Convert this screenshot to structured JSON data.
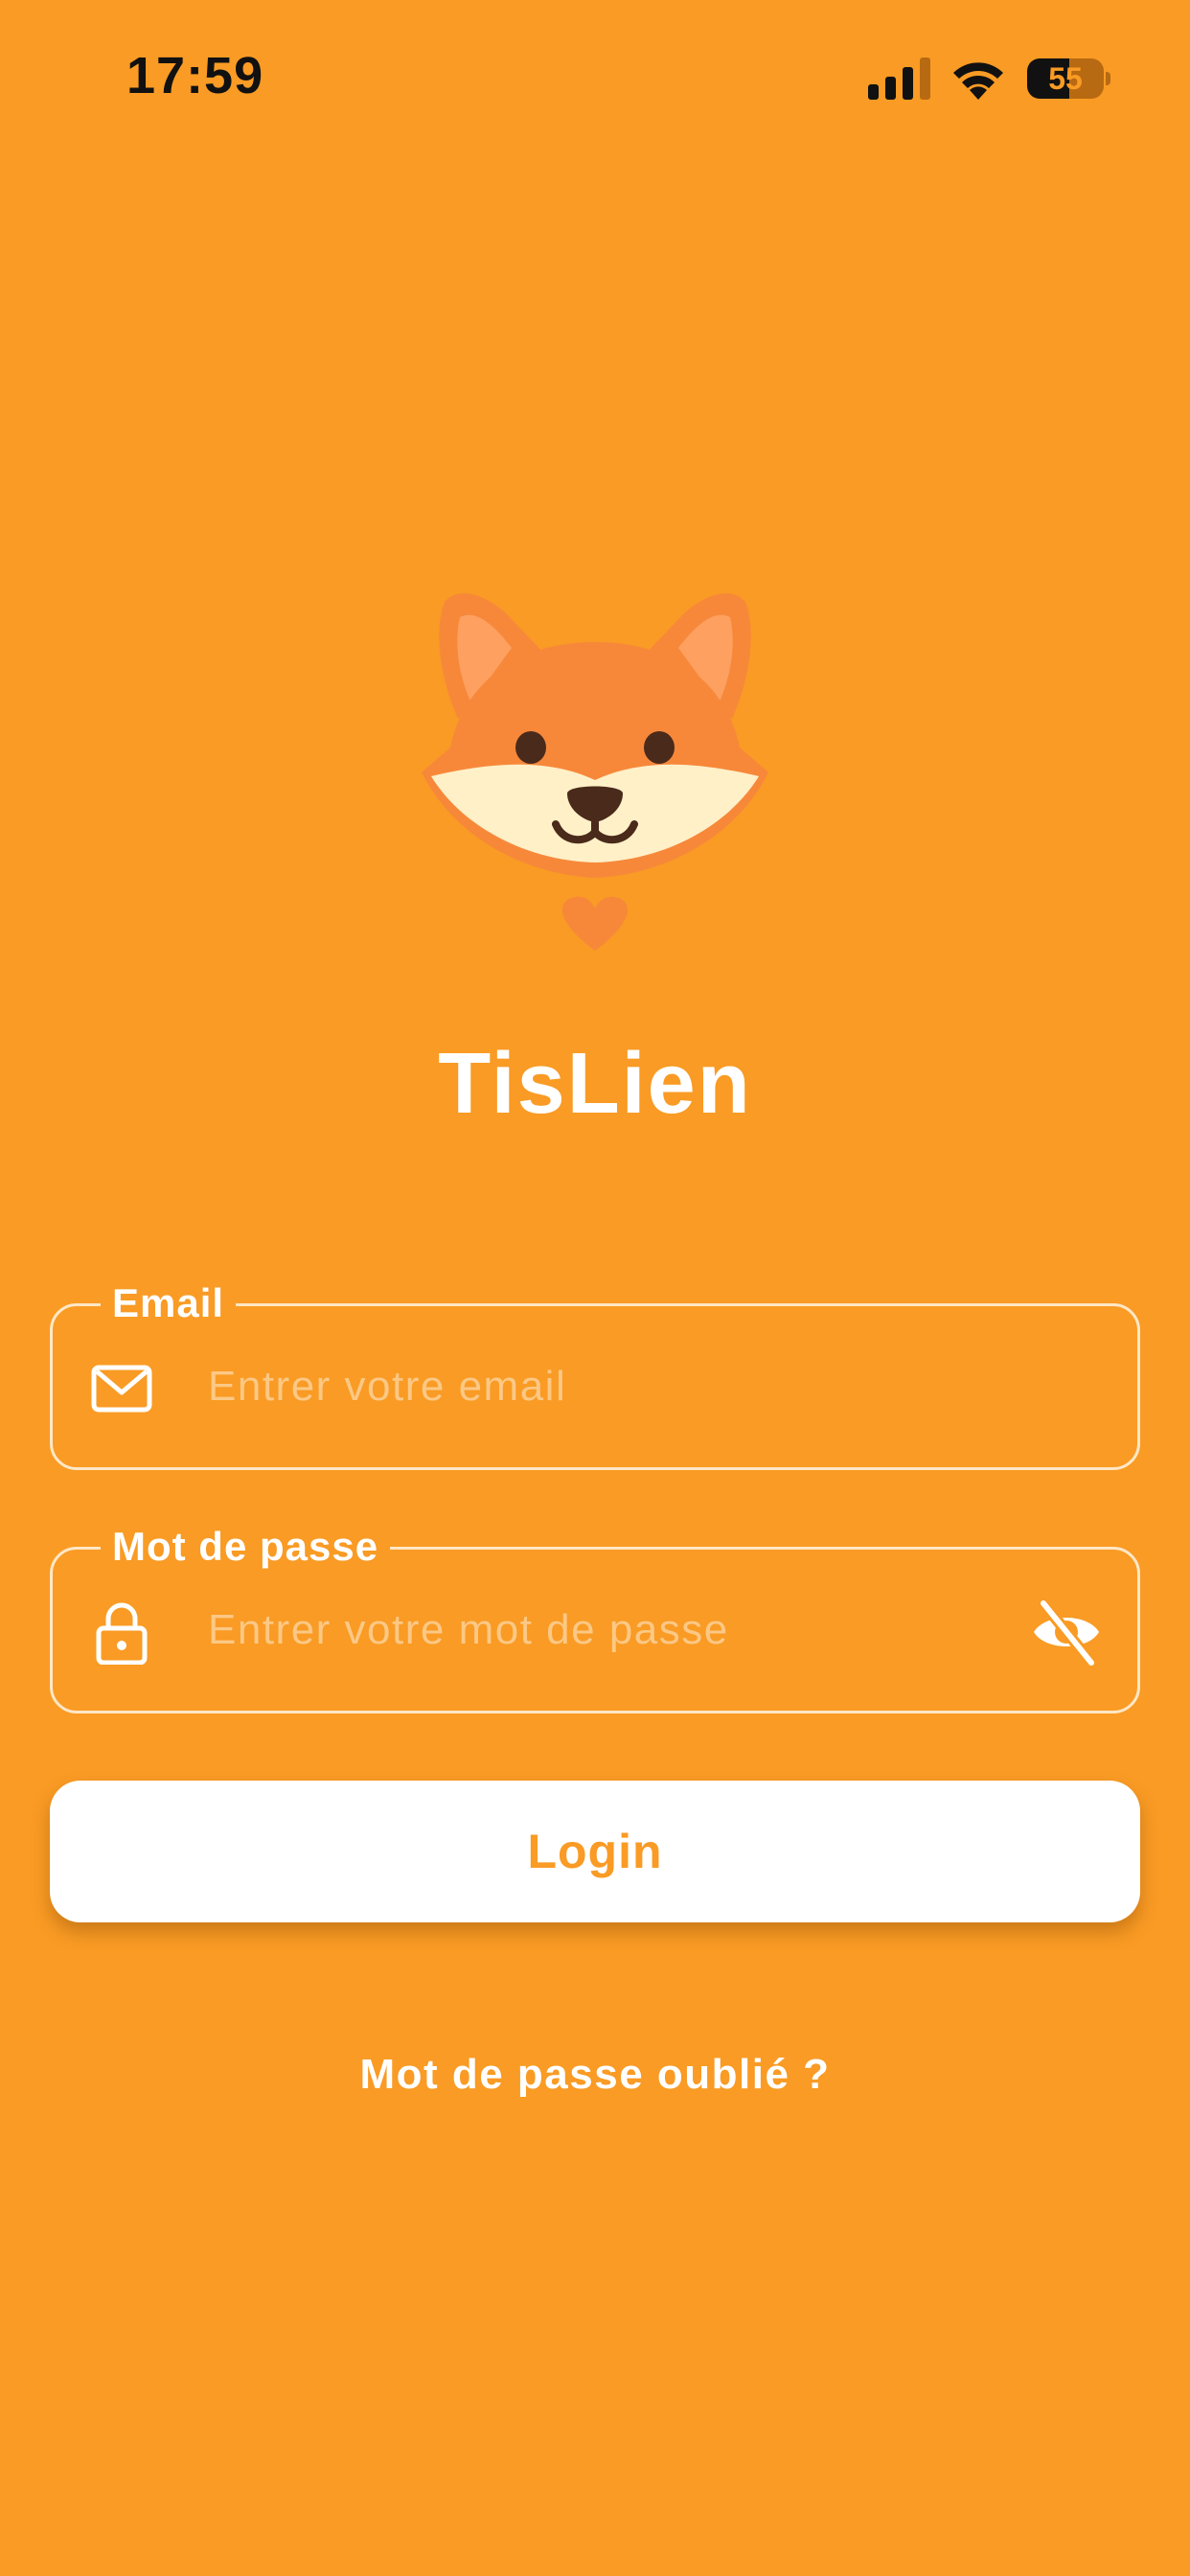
{
  "status_bar": {
    "time": "17:59",
    "battery_level": "55"
  },
  "app": {
    "title": "TisLien"
  },
  "form": {
    "email": {
      "label": "Email",
      "placeholder": "Entrer votre email",
      "value": ""
    },
    "password": {
      "label": "Mot de passe",
      "placeholder": "Entrer votre mot de passe",
      "value": ""
    },
    "login_label": "Login",
    "forgot_label": "Mot de passe oublié ?"
  },
  "icons": {
    "signal": "cellular-signal-icon",
    "wifi": "wifi-icon",
    "battery": "battery-icon",
    "email": "mail-icon",
    "password": "lock-icon",
    "visibility": "eye-off-icon",
    "logo": "fox-logo-icon"
  },
  "colors": {
    "background": "#F99B24",
    "fox_orange": "#F7883A",
    "fox_ear_inner": "#FDA060",
    "fox_cream": "#FFF0C8",
    "fox_dark": "#4A2A1A",
    "heart": "#F7883A",
    "button_background": "#FFFFFF",
    "button_text": "#F99B24",
    "field_border": "#FFE7C6",
    "placeholder": "#FCC885"
  }
}
